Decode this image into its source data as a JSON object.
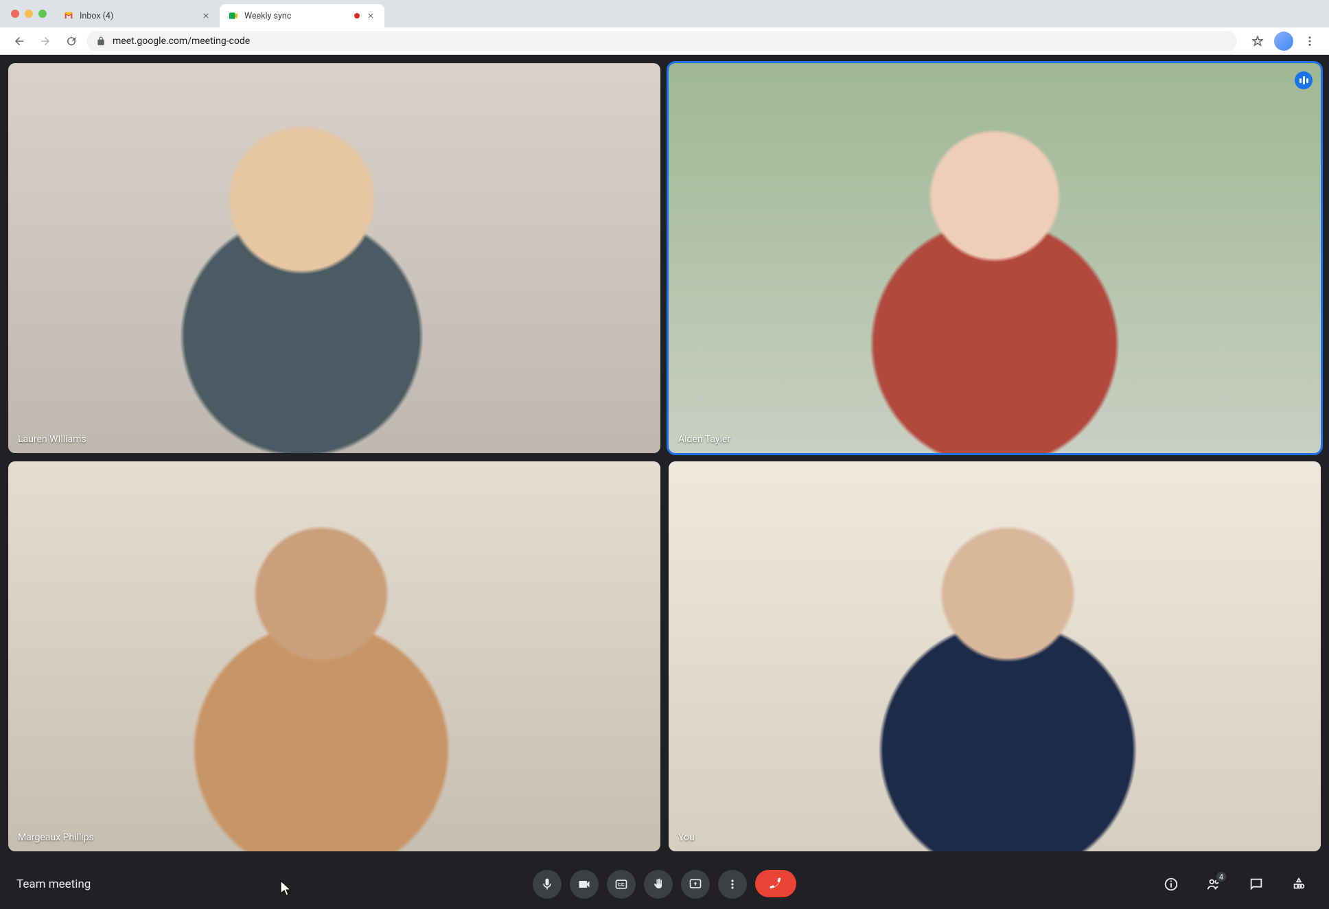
{
  "browser": {
    "tabs": [
      {
        "title": "Inbox (4)",
        "favicon": "gmail",
        "active": false
      },
      {
        "title": "Weekly sync",
        "favicon": "meet",
        "active": true,
        "recording": true
      }
    ],
    "url": "meet.google.com/meeting-code"
  },
  "meeting": {
    "name": "Team meeting",
    "participant_count": "4",
    "tiles": [
      {
        "name": "Lauren WIlliams",
        "speaking": false
      },
      {
        "name": "Aiden Tayler",
        "speaking": true
      },
      {
        "name": "Margeaux Phillips",
        "speaking": false
      },
      {
        "name": "You",
        "speaking": false
      }
    ],
    "controls": {
      "mic": "microphone-icon",
      "camera": "camera-icon",
      "captions": "captions-icon",
      "hand": "raise-hand-icon",
      "present": "present-screen-icon",
      "more": "more-options-icon",
      "leave": "leave-call-icon",
      "info": "meeting-details-icon",
      "people": "people-icon",
      "chat": "chat-icon",
      "activities": "activities-icon"
    }
  },
  "colors": {
    "accent": "#1a73e8",
    "danger": "#ea4335",
    "surface": "#202124",
    "control": "#3c4043"
  }
}
